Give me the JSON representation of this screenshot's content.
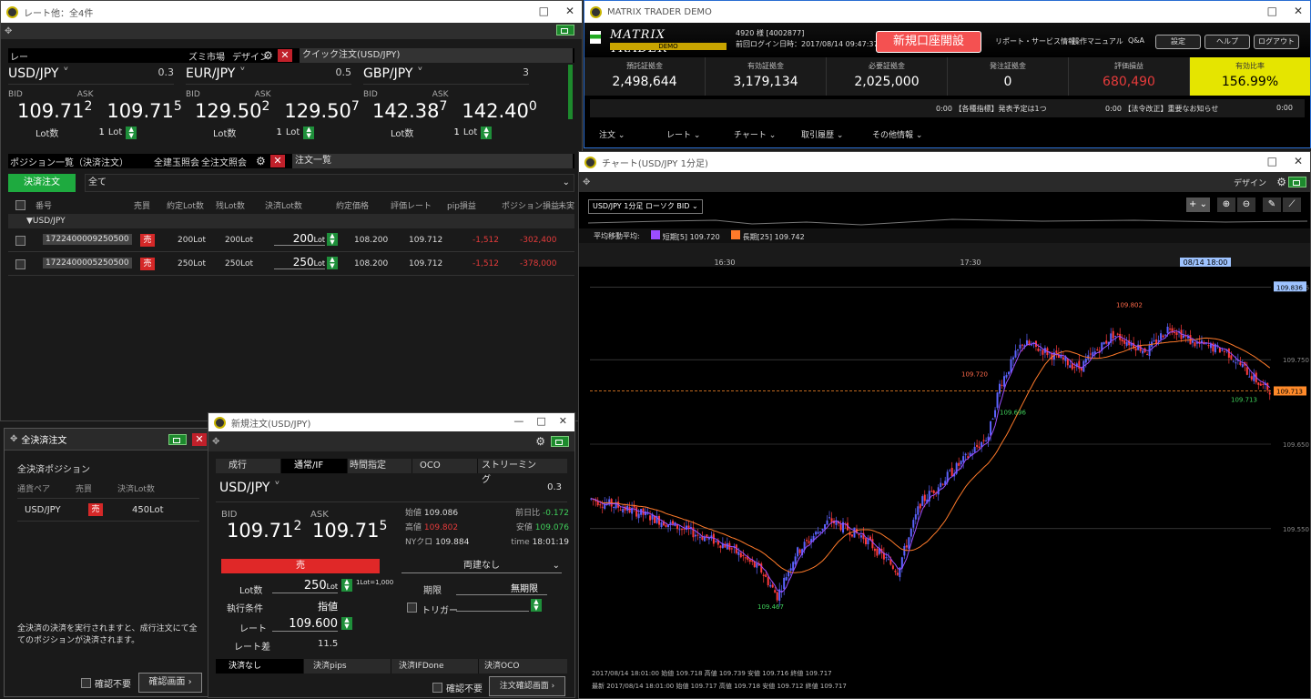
{
  "rate_win": {
    "title": "レート他：全4件",
    "left_label": "レー",
    "mini_label": "ズミ市場",
    "design": "デザイン",
    "quick": "クイック注文(USD/JPY)",
    "pairs": [
      {
        "name": "USD/JPY",
        "spread": "0.3",
        "bid_main": "109.71",
        "bid_sup": "2",
        "ask_main": "109.71",
        "ask_sup": "5",
        "lot": "1"
      },
      {
        "name": "EUR/JPY",
        "spread": "0.5",
        "bid_main": "129.50",
        "bid_sup": "2",
        "ask_main": "129.50",
        "ask_sup": "7",
        "lot": "1"
      },
      {
        "name": "GBP/JPY",
        "spread": "3",
        "bid_main": "142.38",
        "bid_sup": "7",
        "ask_main": "142.40",
        "ask_sup": "0",
        "lot": "1"
      }
    ],
    "bid": "BID",
    "ask": "ASK",
    "lot_label": "Lot数",
    "lot_unit": "Lot"
  },
  "pos": {
    "title": "ポジション一覧（決済注文）",
    "all_close": "全建玉照会",
    "sel_close": "全注文照会",
    "order_list": "注文一覧",
    "btn": "決済注文",
    "filter": "全て",
    "headers": [
      "番号",
      "売買",
      "約定Lot数",
      "残Lot数",
      "決済Lot数",
      "約定価格",
      "評価レート",
      "pip損益",
      "ポジション損益",
      "未実"
    ],
    "group": "▼USD/JPY",
    "rows": [
      {
        "id": "1722400009250500",
        "side": "売",
        "qty": "200Lot",
        "rem": "200Lot",
        "close": "200",
        "price": "108.200",
        "rate": "109.712",
        "pip": "-1,512",
        "pl": "-302,400"
      },
      {
        "id": "1722400005250500",
        "side": "売",
        "qty": "250Lot",
        "rem": "250Lot",
        "close": "250",
        "price": "108.200",
        "rate": "109.712",
        "pip": "-1,512",
        "pl": "-378,000"
      }
    ]
  },
  "allclose": {
    "title": "全決済注文",
    "sub": "全決済ポジション",
    "headers": [
      "通貨ペア",
      "売買",
      "決済Lot数"
    ],
    "row": {
      "pair": "USD/JPY",
      "side": "売",
      "lots": "450Lot"
    },
    "note": "全決済の決済を実行されますと、成行注文にて全てのポジションが決済されます。",
    "confirm": "確認不要",
    "btn": "確認画面"
  },
  "neworder": {
    "title": "新規注文(USD/JPY)",
    "tabs": [
      "成行",
      "通常/IF",
      "時間指定",
      "OCO",
      "ストリーミング"
    ],
    "pair": "USD/JPY",
    "spread": "0.3",
    "bid_main": "109.71",
    "bid_sup": "2",
    "ask_main": "109.71",
    "ask_sup": "5",
    "bid": "BID",
    "ask": "ASK",
    "stats": [
      {
        "k": "始値",
        "v": "109.086",
        "c": "#ddd"
      },
      {
        "k": "前日比",
        "v": "-0.172",
        "c": "#3fcf5a"
      },
      {
        "k": "高値",
        "v": "109.802",
        "c": "#e53b3b"
      },
      {
        "k": "安値",
        "v": "109.076",
        "c": "#3fcf5a"
      },
      {
        "k": "NYクロ",
        "v": "109.884",
        "c": "#ddd"
      },
      {
        "k": "time",
        "v": "18:01:19",
        "c": "#ddd"
      }
    ],
    "side": "売",
    "dir": "両建なし",
    "lot_label": "Lot数",
    "lot": "250",
    "lot_unit": "Lot",
    "lot_note": "1Lot=1,000",
    "exec_label": "執行条件",
    "exec": "指値",
    "rate_label": "レート",
    "rate": "109.600",
    "gap_label": "レート差",
    "gap": "11.5",
    "expiry_label": "期限",
    "expiry": "無期限",
    "trigger": "トリガー",
    "btabs": [
      "決済なし",
      "決済pips",
      "決済IFDone",
      "決済OCO"
    ],
    "confirm": "確認不要",
    "btn": "注文確認画面"
  },
  "mt": {
    "title": "MATRIX TRADER DEMO",
    "brand": "MATRIX TRADER",
    "demo": "DEMO",
    "acct": "4920 様 [4002877]",
    "login": "前回ログイン日時：2017/08/14 09:47:37",
    "open_btn": "新規口座開設",
    "links": [
      "リポート・サービス情報",
      "操作マニュアル",
      "Q&A"
    ],
    "btns": [
      "設定",
      "ヘルプ",
      "ログアウト"
    ],
    "stats": [
      {
        "k": "預託証拠金",
        "v": "2,498,644"
      },
      {
        "k": "有効証拠金",
        "v": "3,179,134"
      },
      {
        "k": "必要証拠金",
        "v": "2,025,000"
      },
      {
        "k": "発注証拠金",
        "v": "0"
      },
      {
        "k": "評価損益",
        "v": "680,490"
      },
      {
        "k": "有効比率",
        "v": "156.99%"
      }
    ],
    "ticker1": "0:00 【各種指標】発表予定は1つ",
    "ticker2": "0:00 【法令改正】重要なお知らせ",
    "ticker3": "0:00",
    "menu": [
      "注文",
      "レート",
      "チャート",
      "取引履歴",
      "その他情報"
    ]
  },
  "chart_win": {
    "title": "チャート(USD/JPY 1分足)",
    "design": "デザイン",
    "sel": "USD/JPY 1分足 ローソク BID",
    "ind": "平均移動平均:",
    "ma1": "短期[5] 109.720",
    "ma2": "長期[25] 109.742",
    "ma1_color": "#9b4dff",
    "ma2_color": "#ff7a2a",
    "footer1": "2017/08/14 18:01:00 始値 109.718 高値 109.739 安値 109.716 終値 109.717",
    "footer2": "最新 2017/08/14 18:01:00 始値 109.717 高値 109.718 安値 109.712 終値 109.717"
  },
  "chart_data": {
    "type": "candlestick",
    "time_labels": [
      "16:30",
      "17:30",
      "08/14 18:00"
    ],
    "yticks": [
      "109.836",
      "109.750",
      "109.650",
      "109.550"
    ],
    "ylim": [
      109.44,
      109.86
    ],
    "current": "109.713",
    "hi_label": "109.802",
    "lo_label": "109.467",
    "mid_label": "109.720",
    "low2_label": "109.696",
    "end_label": "109.713"
  }
}
